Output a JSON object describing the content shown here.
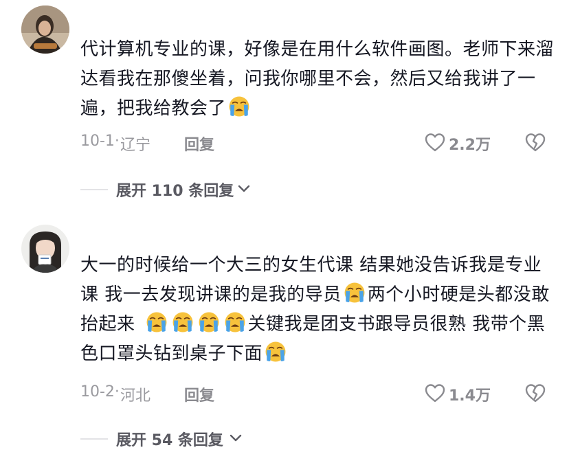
{
  "comments": [
    {
      "text_parts": [
        "代计算机专业的课，好像是在用什么软件画图。老师下来溜达看我在那傻坐着，问我你哪里不会，然后又给我讲了一遍，把我给教会了"
      ],
      "date": "10-1·",
      "location": "辽宁",
      "reply_label": "回复",
      "like_count": "2.2万",
      "expand_label": "展开 110 条回复"
    },
    {
      "text_parts": [
        "大一的时候给一个大三的女生代课 结果她没告诉我是专业课 我一去发现讲课的是我的导员",
        "两个小时硬是头都没敢抬起来",
        "关键我是团支书跟导员很熟 我带个黑色口罩头钻到桌子下面"
      ],
      "date": "10-2·",
      "location": "河北",
      "reply_label": "回复",
      "like_count": "1.4万",
      "expand_label": "展开 54 条回复"
    }
  ],
  "icons": {
    "emoji": "loudly-crying-face-emoji",
    "like": "heart-outline-icon",
    "dislike": "broken-heart-icon",
    "expand": "chevron-down-icon"
  },
  "colors": {
    "text_primary": "#161823",
    "text_secondary": "#9a9a9f",
    "expand_text": "#5a5a62",
    "emoji_face": "#f7c23c",
    "emoji_tears": "#4aa3e8"
  }
}
